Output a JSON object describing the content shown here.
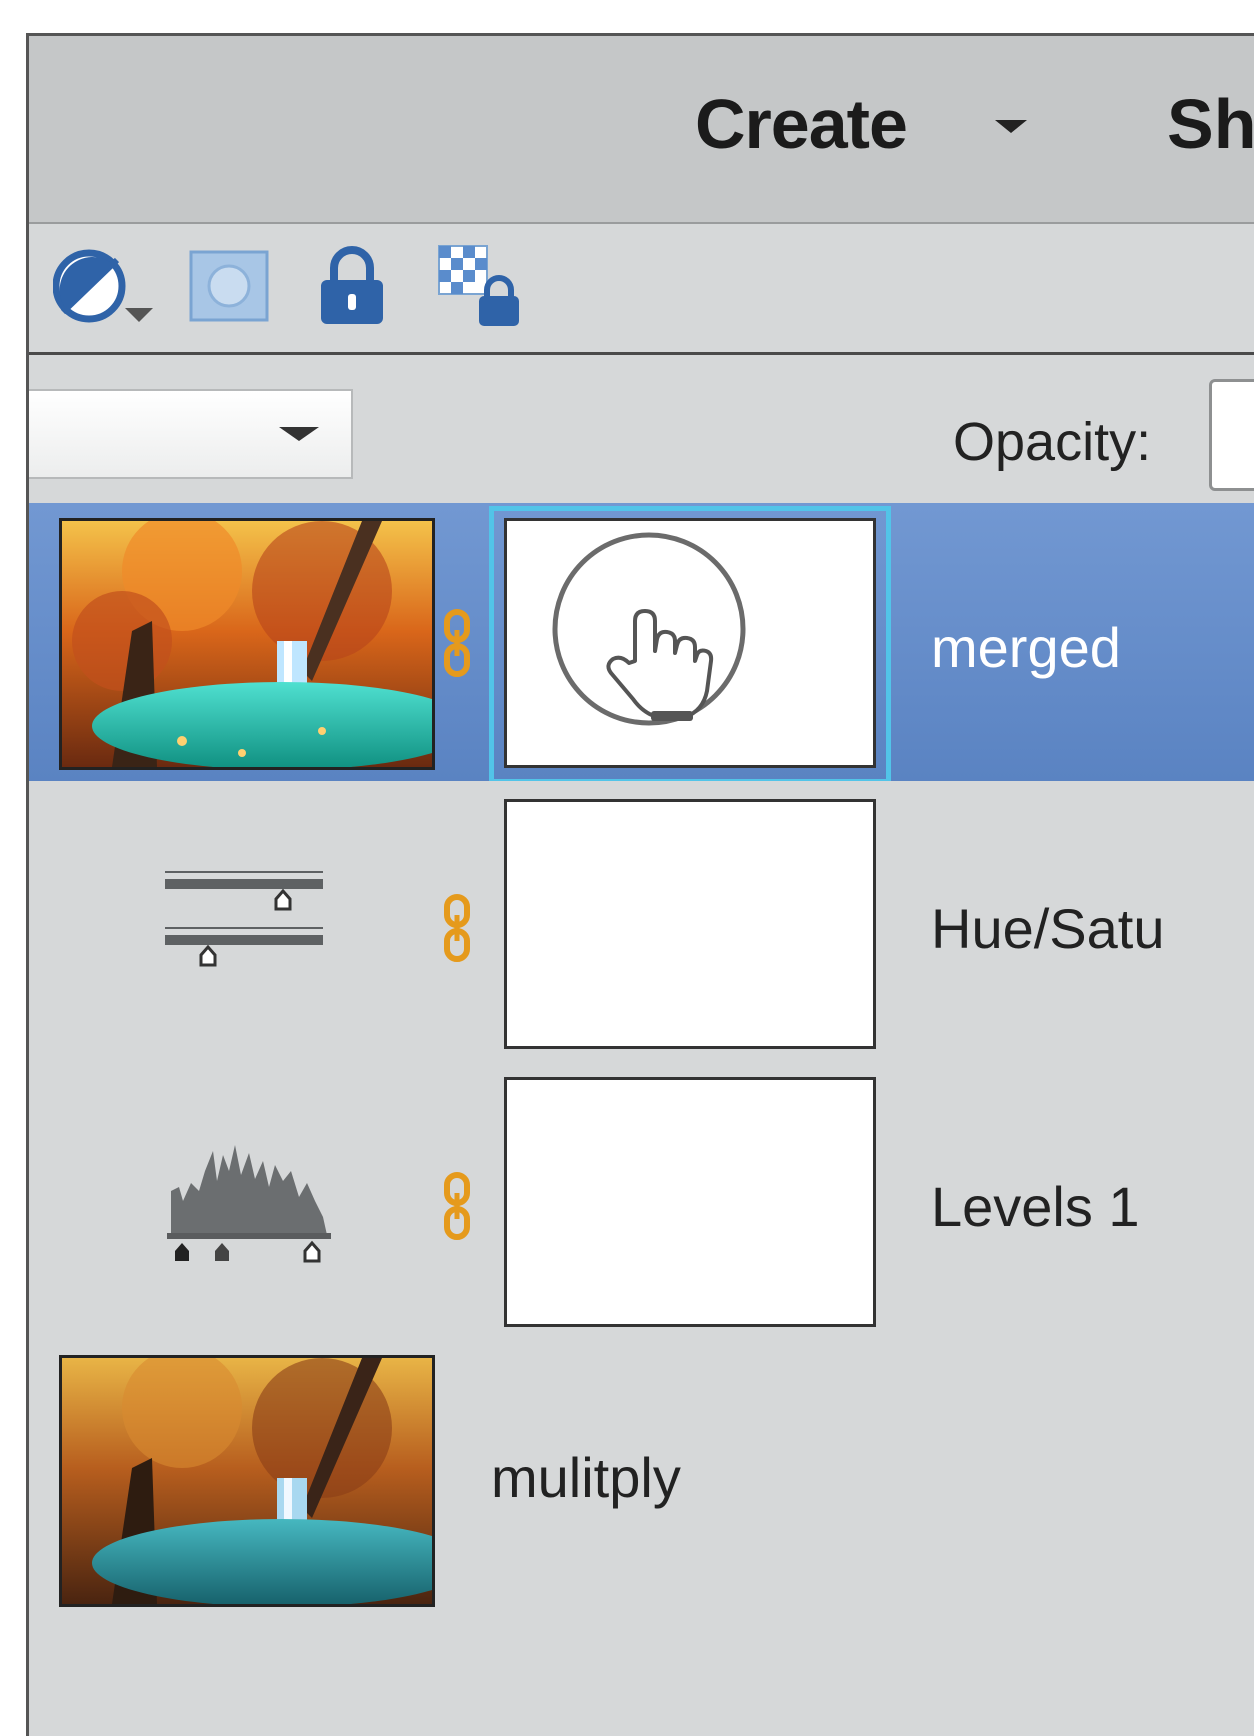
{
  "header": {
    "create_label": "Create",
    "share_label_partial": "Sh"
  },
  "toolbar": {
    "icons": [
      "adjustment-layer-icon",
      "layer-mask-icon",
      "lock-icon",
      "lock-transparency-icon"
    ]
  },
  "controls": {
    "blend_mode_value": "",
    "opacity_label": "Opacity:"
  },
  "layers": [
    {
      "name": "merged",
      "selected": true,
      "has_mask": true,
      "cursor": "hand-pointer-icon"
    },
    {
      "name": "Hue/Satu",
      "selected": false,
      "type": "hue-saturation-adjustment",
      "has_mask": true
    },
    {
      "name": "Levels 1",
      "selected": false,
      "type": "levels-adjustment",
      "has_mask": true
    },
    {
      "name": "mulitply",
      "selected": false,
      "has_mask": false
    }
  ],
  "colors": {
    "selection_blue": "#5f88c6",
    "link_orange": "#e59a1c",
    "panel_gray": "#d6d8d9",
    "mask_highlight": "#52c4e8"
  }
}
